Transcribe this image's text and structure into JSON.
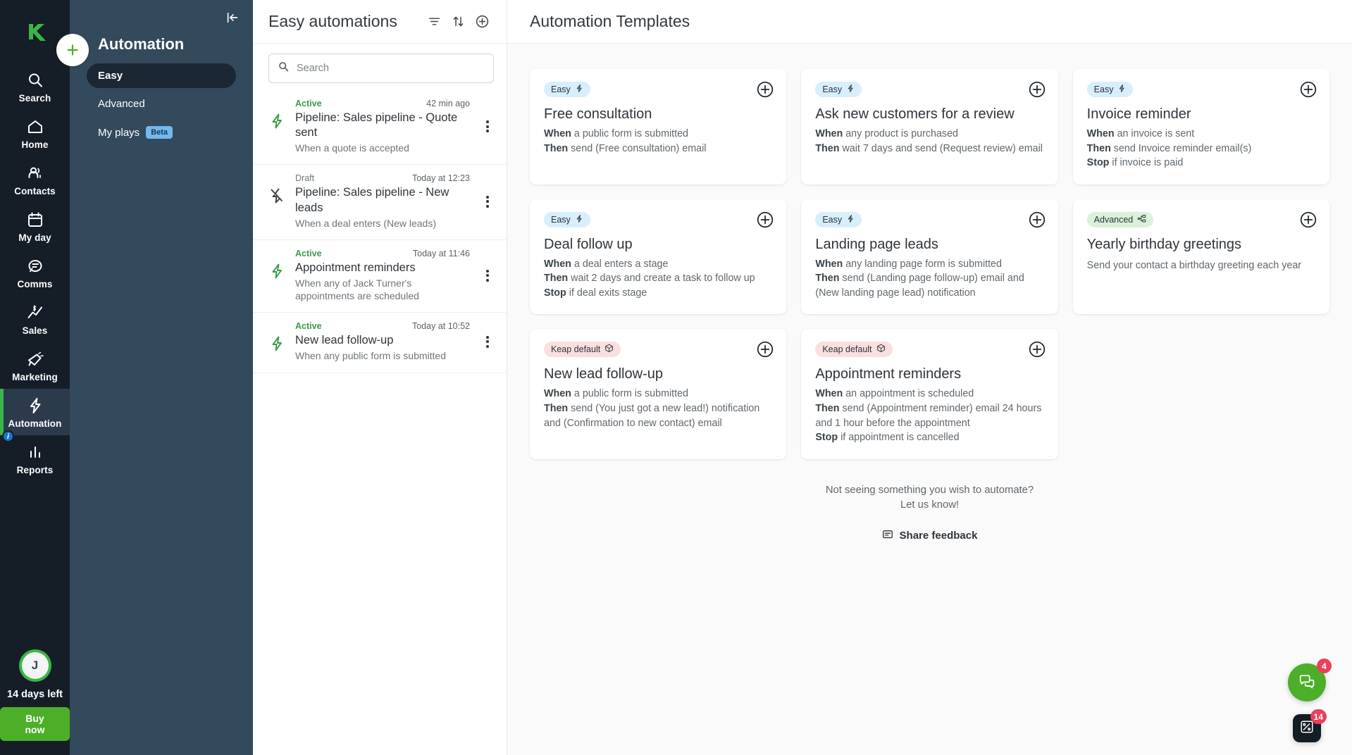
{
  "rail": {
    "logo_icon": "keap-logo-icon",
    "plus_button": "add-icon",
    "items": [
      {
        "label": "Search",
        "icon": "search-icon",
        "active": false
      },
      {
        "label": "Home",
        "icon": "home-icon",
        "active": false
      },
      {
        "label": "Contacts",
        "icon": "contacts-icon",
        "active": false
      },
      {
        "label": "My day",
        "icon": "calendar-icon",
        "active": false
      },
      {
        "label": "Comms",
        "icon": "chat-icon",
        "active": false
      },
      {
        "label": "Sales",
        "icon": "sales-chart-icon",
        "active": false
      },
      {
        "label": "Marketing",
        "icon": "megaphone-icon",
        "active": false
      },
      {
        "label": "Automation",
        "icon": "lightning-icon",
        "active": true
      },
      {
        "label": "Reports",
        "icon": "bar-chart-icon",
        "active": false
      }
    ],
    "info_badge": "i",
    "avatar_initial": "J",
    "days_left": "14 days left",
    "buy_now": "Buy now"
  },
  "subnav": {
    "title": "Automation",
    "collapse_icon": "collapse-panel-icon",
    "items": [
      {
        "label": "Easy",
        "selected": true,
        "badge": ""
      },
      {
        "label": "Advanced",
        "selected": false,
        "badge": ""
      },
      {
        "label": "My plays",
        "selected": false,
        "badge": "Beta"
      }
    ]
  },
  "list_panel": {
    "title": "Easy automations",
    "filter_icon": "filter-icon",
    "sort_icon": "sort-icon",
    "add_icon": "plus-circle-icon",
    "search": {
      "value": "",
      "placeholder": "Search"
    },
    "rows": [
      {
        "status": "Active",
        "status_kind": "active",
        "time": "42 min ago",
        "name": "Pipeline: Sales pipeline - Quote sent",
        "trigger": "When a quote is accepted",
        "icon": "lightning-icon"
      },
      {
        "status": "Draft",
        "status_kind": "draft",
        "time": "Today at 12:23",
        "name": "Pipeline: Sales pipeline - New leads",
        "trigger": "When a deal enters (New leads)",
        "icon": "lightning-off-icon"
      },
      {
        "status": "Active",
        "status_kind": "active",
        "time": "Today at 11:46",
        "name": "Appointment reminders",
        "trigger": "When any of Jack Turner's appointments are scheduled",
        "icon": "lightning-icon"
      },
      {
        "status": "Active",
        "status_kind": "active",
        "time": "Today at 10:52",
        "name": "New lead follow-up",
        "trigger": "When any public form is submitted",
        "icon": "lightning-icon"
      }
    ]
  },
  "templates": {
    "title": "Automation Templates",
    "add_icon": "plus-circle-icon",
    "cards": [
      {
        "badge": "Easy",
        "badge_kind": "easy",
        "badge_icon": "lightning-icon",
        "name": "Free consultation",
        "lines": [
          {
            "key": "When",
            "text": "a public form is submitted"
          },
          {
            "key": "Then",
            "text": "send (Free consultation) email"
          }
        ],
        "description": ""
      },
      {
        "badge": "Easy",
        "badge_kind": "easy",
        "badge_icon": "lightning-icon",
        "name": "Ask new customers for a review",
        "lines": [
          {
            "key": "When",
            "text": "any product is purchased"
          },
          {
            "key": "Then",
            "text": "wait 7 days and send (Request review) email"
          }
        ],
        "description": ""
      },
      {
        "badge": "Easy",
        "badge_kind": "easy",
        "badge_icon": "lightning-icon",
        "name": "Invoice reminder",
        "lines": [
          {
            "key": "When",
            "text": "an invoice is sent"
          },
          {
            "key": "Then",
            "text": "send Invoice reminder email(s)"
          },
          {
            "key": "Stop",
            "text": "if invoice is paid"
          }
        ],
        "description": ""
      },
      {
        "badge": "Easy",
        "badge_kind": "easy",
        "badge_icon": "lightning-icon",
        "name": "Deal follow up",
        "lines": [
          {
            "key": "When",
            "text": "a deal enters a stage"
          },
          {
            "key": "Then",
            "text": "wait 2 days and create a task to follow up"
          },
          {
            "key": "Stop",
            "text": "if deal exits stage"
          }
        ],
        "description": ""
      },
      {
        "badge": "Easy",
        "badge_kind": "easy",
        "badge_icon": "lightning-icon",
        "name": "Landing page leads",
        "lines": [
          {
            "key": "When",
            "text": "any landing page form is submitted"
          },
          {
            "key": "Then",
            "text": "send (Landing page follow-up) email and (New landing page lead) notification"
          }
        ],
        "description": ""
      },
      {
        "badge": "Advanced",
        "badge_kind": "advanced",
        "badge_icon": "flowchart-icon",
        "name": "Yearly birthday greetings",
        "lines": [],
        "description": "Send your contact a birthday greeting each year"
      },
      {
        "badge": "Keap default",
        "badge_kind": "keap",
        "badge_icon": "package-icon",
        "name": "New lead follow-up",
        "lines": [
          {
            "key": "When",
            "text": "a public form is submitted"
          },
          {
            "key": "Then",
            "text": "send (You just got a new lead!) notification and (Confirmation to new contact) email"
          }
        ],
        "description": ""
      },
      {
        "badge": "Keap default",
        "badge_kind": "keap",
        "badge_icon": "package-icon",
        "name": "Appointment reminders",
        "lines": [
          {
            "key": "When",
            "text": "an appointment is scheduled"
          },
          {
            "key": "Then",
            "text": "send (Appointment reminder) email 24 hours and 1 hour before the appointment"
          },
          {
            "key": "Stop",
            "text": "if appointment is cancelled"
          }
        ],
        "description": ""
      }
    ],
    "footer_line1": "Not seeing something you wish to automate?",
    "footer_line2": "Let us know!",
    "share_feedback": "Share feedback",
    "share_feedback_icon": "feedback-icon"
  },
  "floating": {
    "chat_icon": "chat-bubble-icon",
    "chat_badge": "4",
    "tools_icon": "tools-icon",
    "tools_badge": "14"
  },
  "colors": {
    "brand_green": "#4caf28",
    "active_green": "#3a9b46",
    "rail_bg": "#151d26",
    "subnav_bg": "#33495c",
    "badge_easy": "#d7eefc",
    "badge_advanced": "#d9f2d9",
    "badge_keap": "#fbdfdf",
    "notification_red": "#e8415a"
  }
}
